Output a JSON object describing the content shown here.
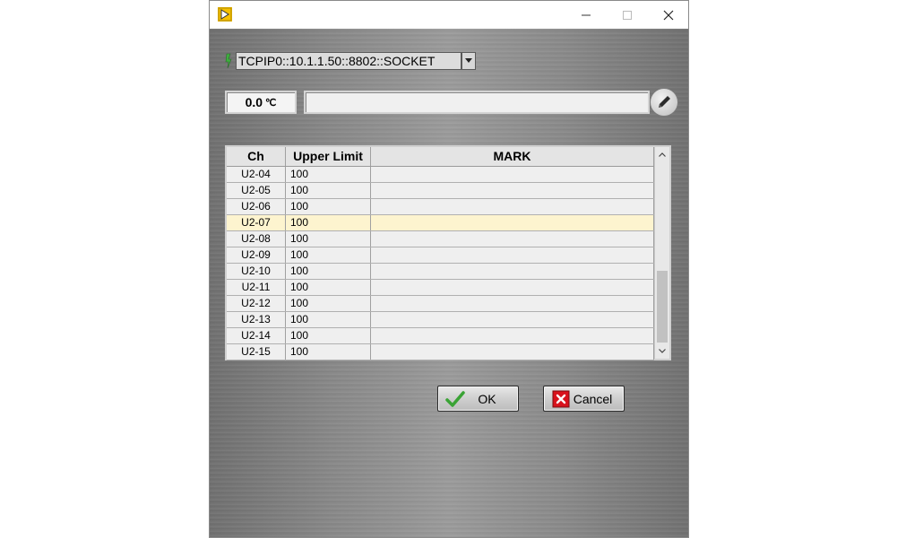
{
  "window": {
    "title": "",
    "controls": {
      "minimize": "minimize",
      "maximize": "maximize",
      "close": "close"
    }
  },
  "resource": {
    "value": "TCPIP0::10.1.1.50::8802::SOCKET"
  },
  "temperature": {
    "value": "0.0",
    "unit": "℃"
  },
  "message": {
    "value": ""
  },
  "table": {
    "columns": [
      "Ch",
      "Upper Limit",
      "MARK"
    ],
    "selected_row": "U2-07",
    "rows": [
      {
        "ch": "U2-04",
        "limit": "100",
        "mark": ""
      },
      {
        "ch": "U2-05",
        "limit": "100",
        "mark": ""
      },
      {
        "ch": "U2-06",
        "limit": "100",
        "mark": ""
      },
      {
        "ch": "U2-07",
        "limit": "100",
        "mark": ""
      },
      {
        "ch": "U2-08",
        "limit": "100",
        "mark": ""
      },
      {
        "ch": "U2-09",
        "limit": "100",
        "mark": ""
      },
      {
        "ch": "U2-10",
        "limit": "100",
        "mark": ""
      },
      {
        "ch": "U2-11",
        "limit": "100",
        "mark": ""
      },
      {
        "ch": "U2-12",
        "limit": "100",
        "mark": ""
      },
      {
        "ch": "U2-13",
        "limit": "100",
        "mark": ""
      },
      {
        "ch": "U2-14",
        "limit": "100",
        "mark": ""
      },
      {
        "ch": "U2-15",
        "limit": "100",
        "mark": ""
      }
    ]
  },
  "buttons": {
    "ok_label": "OK",
    "cancel_label": "Cancel"
  },
  "colors": {
    "selected_row": "#fdf4cf",
    "app_icon": "#f5c000",
    "cancel_icon": "#d8121c",
    "ok_icon": "#3aa335"
  }
}
